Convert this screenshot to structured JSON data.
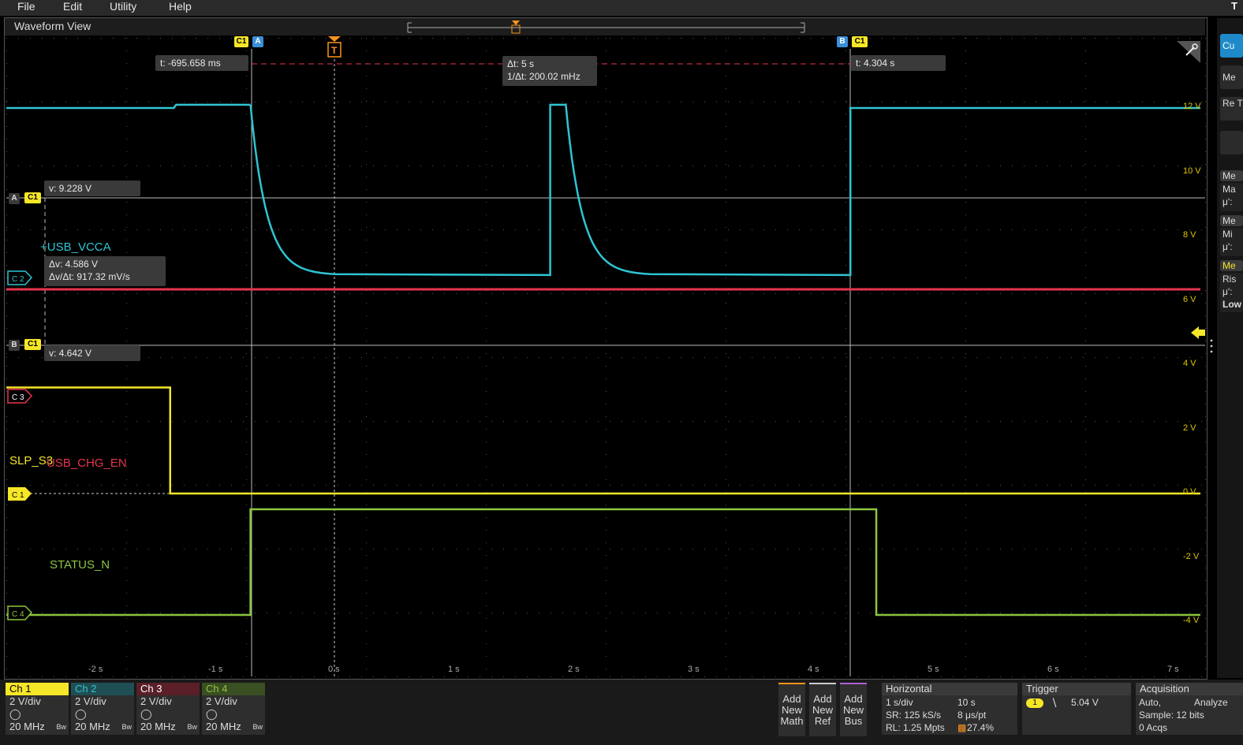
{
  "menu": {
    "file": "File",
    "edit": "Edit",
    "utility": "Utility",
    "help": "Help"
  },
  "corner_glyph": "T",
  "waveform_view": {
    "title": "Waveform View"
  },
  "cursor_readouts": {
    "cursor_a_time": "t: -695.658 ms",
    "delta_t": "Δt: 5 s",
    "inv_delta_t": "1/Δt: 200.02 mHz",
    "cursor_b_time": "t: 4.304 s",
    "cursor_a_volt": "v: 9.228 V",
    "delta_v": "Δv: 4.586 V",
    "dv_dt": "Δv/Δt: 917.32 mV/s",
    "cursor_b_volt": "v: 4.642 V"
  },
  "cursor_markers": {
    "c1": "C1",
    "a": "A",
    "b": "B",
    "trigger": "T"
  },
  "channel_markers": {
    "c1": "C 1",
    "c2": "C 2",
    "c3": "C 3",
    "c4": "C 4"
  },
  "trace_labels": {
    "usb_vcca": "+USB_VCCA",
    "slp_s3": "SLP_S3",
    "usb_chg_en": "USB_CHG_EN",
    "status_n": "STATUS_N"
  },
  "y_axis_labels": [
    "12 V",
    "10 V",
    "8 V",
    "6 V",
    "4 V",
    "2 V",
    "0 V",
    "-2 V",
    "-4 V"
  ],
  "x_axis_labels": [
    "-2 s",
    "-1 s",
    "0 s",
    "1 s",
    "2 s",
    "3 s",
    "4 s",
    "5 s",
    "6 s",
    "7 s"
  ],
  "right_panel_tabs": [
    "Cu",
    "Me",
    "Re T",
    "Me",
    "Ma",
    "μ':",
    "Me",
    "Mi",
    "μ':",
    "Me",
    "Ris",
    "μ':",
    "Low"
  ],
  "colors": {
    "ch1": "#f5e628",
    "ch2": "#2ec5d3",
    "ch3": "#e8344e",
    "ch4": "#8cc63f",
    "trigger": "#f7941d",
    "cursor_a": "#3a8fd6"
  },
  "channels": [
    {
      "name": "Ch 1",
      "scale": "2 V/div",
      "bw": "20 MHz",
      "bw_icon": "Bw"
    },
    {
      "name": "Ch 2",
      "scale": "2 V/div",
      "bw": "20 MHz",
      "bw_icon": "Bw"
    },
    {
      "name": "Ch 3",
      "scale": "2 V/div",
      "bw": "20 MHz",
      "bw_icon": "Bw"
    },
    {
      "name": "Ch 4",
      "scale": "2 V/div",
      "bw": "20 MHz",
      "bw_icon": "Bw"
    }
  ],
  "add_buttons": {
    "math": "Add New Math",
    "ref": "Add New Ref",
    "bus": "Add New Bus"
  },
  "horizontal": {
    "title": "Horizontal",
    "scale": "1 s/div",
    "duration": "10 s",
    "sr": "SR: 125 kS/s",
    "pt": "8 μs/pt",
    "rl": "RL: 1.25 Mpts",
    "pct": "27.4%"
  },
  "trigger": {
    "title": "Trigger",
    "source": "1",
    "level": "5.04 V"
  },
  "acquisition": {
    "title": "Acquisition",
    "mode": "Auto,",
    "analyze": "Analyze",
    "sample": "Sample: 12 bits",
    "acqs": "0 Acqs"
  }
}
